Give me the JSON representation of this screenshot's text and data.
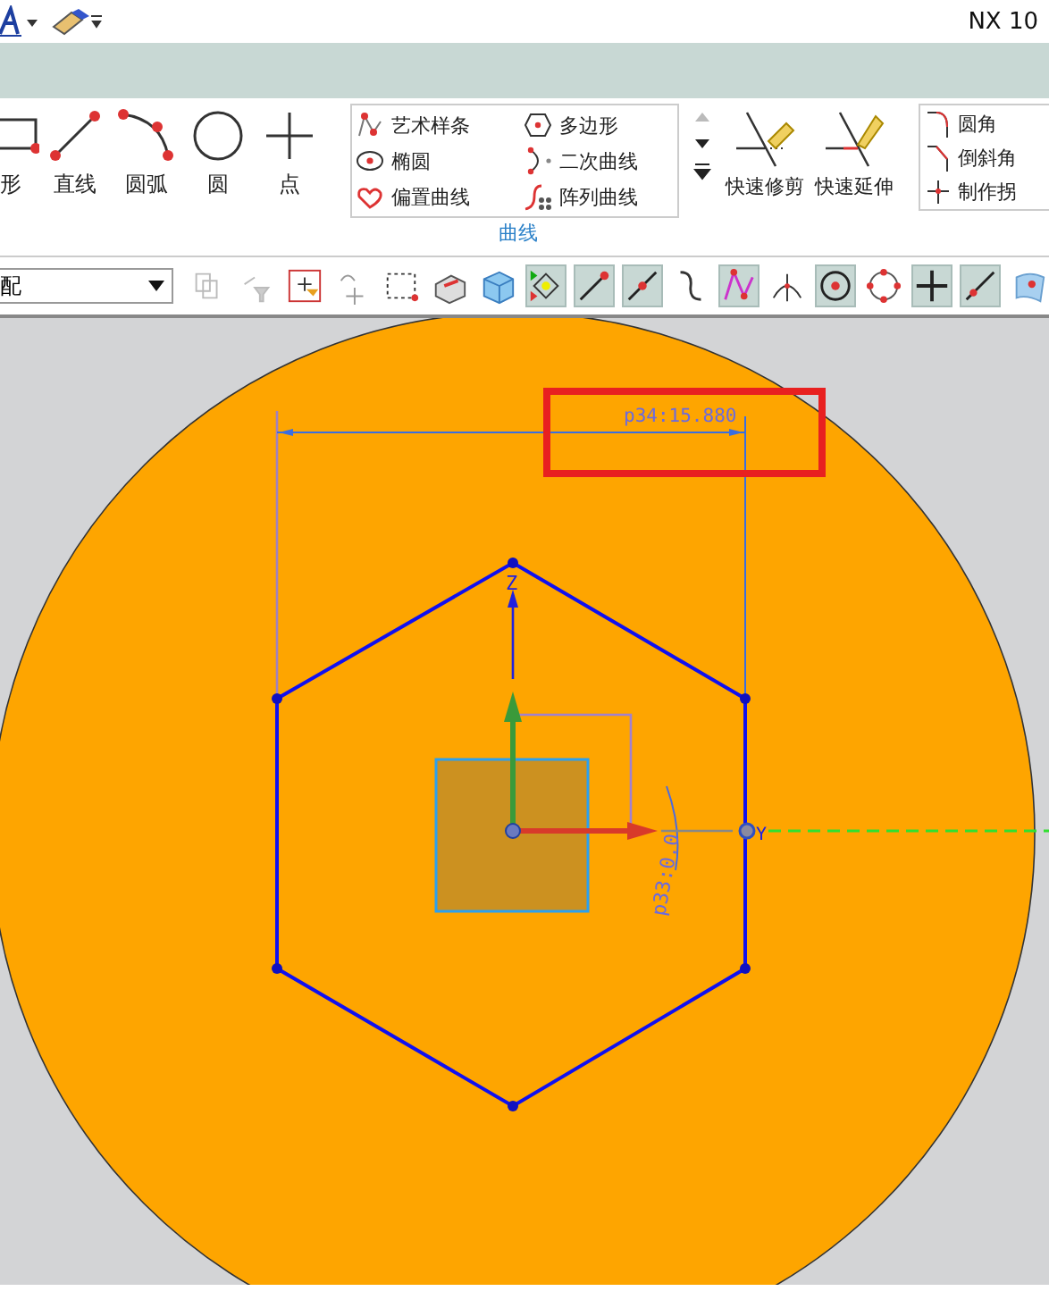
{
  "title_bar": {
    "title": "NX 10"
  },
  "ribbon": {
    "large_tools": [
      {
        "label": "形"
      },
      {
        "label": "直线"
      },
      {
        "label": "圆弧"
      },
      {
        "label": "圆"
      },
      {
        "label": "点"
      }
    ],
    "curve_gallery": [
      "艺术样条",
      "多边形",
      "椭圆",
      "二次曲线",
      "偏置曲线",
      "阵列曲线"
    ],
    "group_label": "曲线",
    "edit_tools": [
      "快速修剪",
      "快速延伸"
    ],
    "corner_tools": [
      "圆角",
      "倒斜角",
      "制作拐"
    ]
  },
  "toolbar": {
    "filter_value": "配",
    "buttons": [
      {
        "selected": false
      },
      {
        "selected": false
      },
      {
        "selected": false
      },
      {
        "selected": false
      },
      {
        "selected": false
      },
      {
        "selected": false
      },
      {
        "selected": false
      },
      {
        "selected": true
      },
      {
        "selected": true
      },
      {
        "selected": true
      },
      {
        "selected": false
      },
      {
        "selected": true
      },
      {
        "selected": false
      },
      {
        "selected": true
      },
      {
        "selected": false
      },
      {
        "selected": true
      },
      {
        "selected": true
      },
      {
        "selected": false
      }
    ]
  },
  "canvas": {
    "dimension_width": "p34:15.880",
    "dimension_angle": "p33:0.0",
    "axis_z": "Z",
    "axis_y": "Y"
  }
}
